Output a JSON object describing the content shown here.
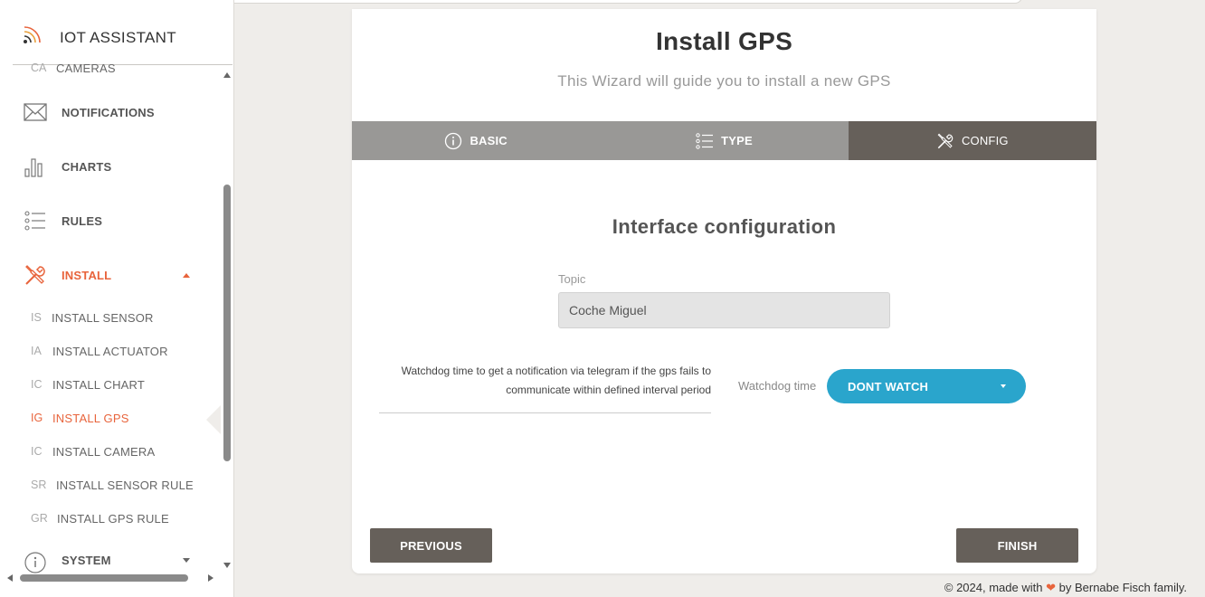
{
  "sidebar": {
    "brand": "IOT ASSISTANT",
    "partial_item": {
      "abbr": "CA",
      "label": "CAMERAS"
    },
    "items": [
      {
        "label": "NOTIFICATIONS",
        "icon": "envelope-icon"
      },
      {
        "label": "CHARTS",
        "icon": "bar-chart-icon"
      },
      {
        "label": "RULES",
        "icon": "list-icon"
      },
      {
        "label": "INSTALL",
        "icon": "tools-icon"
      },
      {
        "label": "SYSTEM",
        "icon": "info-icon"
      }
    ],
    "subitems": [
      {
        "abbr": "IS",
        "label": "INSTALL SENSOR"
      },
      {
        "abbr": "IA",
        "label": "INSTALL ACTUATOR"
      },
      {
        "abbr": "IC",
        "label": "INSTALL CHART"
      },
      {
        "abbr": "IG",
        "label": "INSTALL GPS"
      },
      {
        "abbr": "IC",
        "label": "INSTALL CAMERA"
      },
      {
        "abbr": "SR",
        "label": "INSTALL SENSOR RULE"
      },
      {
        "abbr": "GR",
        "label": "INSTALL GPS RULE"
      }
    ],
    "active_item": "INSTALL",
    "active_subitem": "INSTALL GPS"
  },
  "wizard": {
    "title": "Install GPS",
    "subtitle": "This Wizard will guide you to install a new GPS",
    "tabs": [
      {
        "label": "BASIC",
        "icon": "info-circle-icon"
      },
      {
        "label": "TYPE",
        "icon": "list-icon"
      },
      {
        "label": "CONFIG",
        "icon": "tools-icon"
      }
    ],
    "active_tab": "CONFIG",
    "section_title": "Interface configuration",
    "topic": {
      "label": "Topic",
      "value": "Coche Miguel"
    },
    "watchdog": {
      "description": "Watchdog time to get a notification via telegram if the gps fails to communicate within defined interval period",
      "label": "Watchdog time",
      "selected": "DONT WATCH"
    },
    "buttons": {
      "previous": "PREVIOUS",
      "finish": "FINISH"
    }
  },
  "footer": {
    "prefix": "© 2024, made with",
    "suffix": "by Bernabe Fisch family."
  },
  "colors": {
    "accent": "#e8643c",
    "tab_bg": "#999896",
    "tab_active": "#66605a",
    "select_bg": "#2aa5cc",
    "button_bg": "#66605a"
  }
}
